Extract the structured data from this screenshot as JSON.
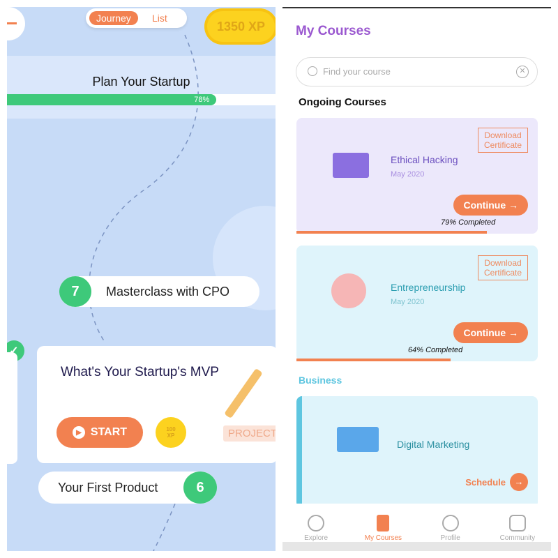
{
  "journey": {
    "toggle": {
      "journey": "Journey",
      "list": "List"
    },
    "xp": "1350 XP",
    "module_title": "Plan Your Startup",
    "progress_label": "78%",
    "progress": 0.78,
    "lesson7": {
      "number": "7",
      "title": "Masterclass with CPO"
    },
    "current": {
      "title": "What's Your Startup's MVP",
      "start": "START",
      "xp_coin": "100 XP",
      "tag": "PROJECT"
    },
    "lesson6": {
      "number": "6",
      "title": "Your First Product"
    }
  },
  "courses": {
    "title": "My Courses",
    "search_placeholder": "Find your course",
    "section_ongoing": "Ongoing Courses",
    "ongoing": [
      {
        "name": "Ethical Hacking",
        "date": "May 2020",
        "download": "Download Certificate",
        "action": "Continue",
        "completed": "79% Completed",
        "progress": 0.79
      },
      {
        "name": "Entrepreneurship",
        "date": "May 2020",
        "download": "Download Certificate",
        "action": "Continue",
        "completed": "64% Completed",
        "progress": 0.64
      }
    ],
    "section_business": "Business",
    "business": [
      {
        "name": "Digital Marketing",
        "action": "Schedule"
      }
    ],
    "nav": [
      {
        "label": "Explore"
      },
      {
        "label": "My Courses"
      },
      {
        "label": "Profile"
      },
      {
        "label": "Community"
      }
    ]
  },
  "colors": {
    "accent": "#f28150",
    "green": "#3ec97a",
    "purple": "#9b59d0",
    "teal": "#2a9db0"
  }
}
